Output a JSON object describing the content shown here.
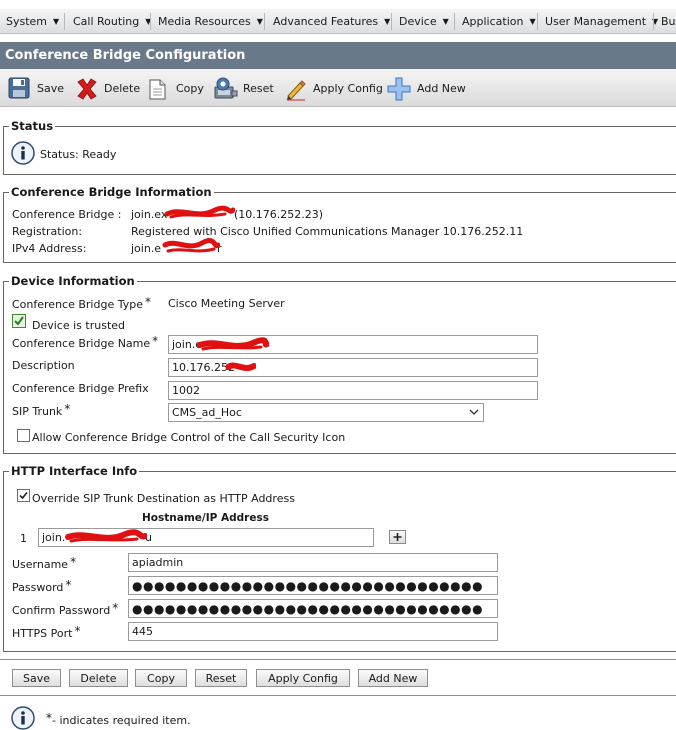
{
  "menu": {
    "items": [
      "System",
      "Call Routing",
      "Media Resources",
      "Advanced Features",
      "Device",
      "Application",
      "User Management",
      "Bu"
    ]
  },
  "page_title": "Conference Bridge Configuration",
  "toolbar": {
    "save": "Save",
    "delete": "Delete",
    "copy": "Copy",
    "reset": "Reset",
    "apply_config": "Apply Config",
    "add_new": "Add New"
  },
  "status": {
    "legend": "Status",
    "text": "Status: Ready"
  },
  "bridge_info": {
    "legend": "Conference Bridge Information",
    "bridge_label": "Conference Bridge :",
    "bridge_value": "join.ex",
    "bridge_ip": "(10.176.252.23)",
    "registration_label": "Registration:",
    "registration_value": "Registered with Cisco Unified Communications Manager 10.176.252.11",
    "ipv4_label": "IPv4 Address:",
    "ipv4_value": "join.e",
    "ipv4_tail": "r"
  },
  "device_info": {
    "legend": "Device Information",
    "type_label": "Conference Bridge Type",
    "type_value": "Cisco Meeting Server",
    "trusted_label": "Device is trusted",
    "name_label": "Conference Bridge Name",
    "name_value": "join.e",
    "description_label": "Description",
    "description_value": "10.176.252",
    "prefix_label": "Conference Bridge Prefix",
    "prefix_value": "1002",
    "sip_trunk_label": "SIP Trunk",
    "sip_trunk_value": "CMS_ad_Hoc",
    "allow_control_label": "Allow Conference Bridge Control of the Call Security Icon",
    "allow_control_checked": false
  },
  "http_info": {
    "legend": "HTTP Interface Info",
    "override_label": "Override SIP Trunk Destination as HTTP Address",
    "override_checked": true,
    "hostname_header": "Hostname/IP Address",
    "row_index": "1",
    "hostname_value": "join.",
    "hostname_tail": "u",
    "username_label": "Username",
    "username_value": "apiadmin",
    "password_label": "Password",
    "password_value": "●●●●●●●●●●●●●●●●●●●●●●●●●●●●●●●●",
    "confirm_label": "Confirm Password",
    "confirm_value": "●●●●●●●●●●●●●●●●●●●●●●●●●●●●●●●●",
    "https_port_label": "HTTPS Port",
    "https_port_value": "445"
  },
  "bottom_buttons": {
    "save": "Save",
    "delete": "Delete",
    "copy": "Copy",
    "reset": "Reset",
    "apply_config": "Apply Config",
    "add_new": "Add New"
  },
  "footer": {
    "required_marker": "*",
    "required_text": "- indicates required item."
  },
  "icons": {
    "info": "info-icon",
    "save": "floppy-disk-icon",
    "delete": "red-x-icon",
    "copy": "copy-document-icon",
    "reset": "reset-icon",
    "apply": "pencil-icon",
    "add": "plus-cross-icon"
  },
  "colors": {
    "title_bar": "#6a7989",
    "delete_red": "#d21a1a",
    "add_blue": "#3a78c8",
    "redaction": "#e01010"
  }
}
